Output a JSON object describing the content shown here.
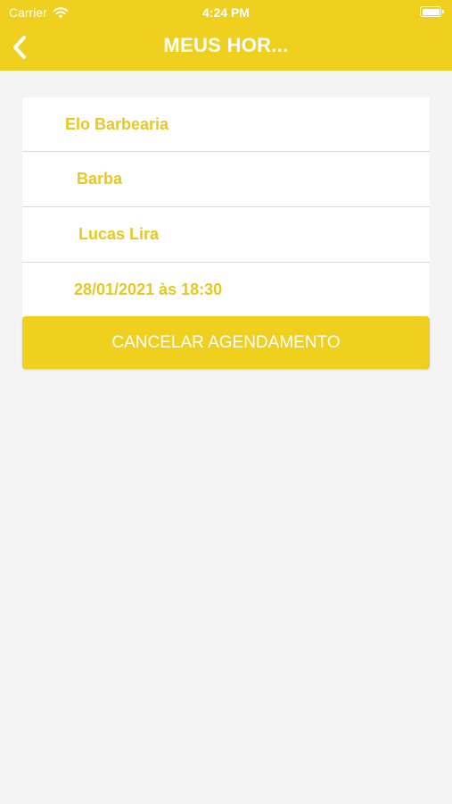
{
  "status_bar": {
    "carrier": "Carrier",
    "time": "4:24 PM",
    "wifi_icon": "wifi-icon",
    "battery_icon": "battery-icon"
  },
  "nav": {
    "back_icon": "chevron-left-icon",
    "title": "MEUS HOR..."
  },
  "appointment": {
    "barbershop": "Elo Barbearia",
    "service": "Barba",
    "barber": "Lucas Lira",
    "datetime": "28/01/2021 às 18:30"
  },
  "actions": {
    "cancel_label": "CANCELAR AGENDAMENTO"
  },
  "colors": {
    "brand_yellow": "#efd01e",
    "text_yellow": "#e9c81f",
    "background": "#f4f4f4"
  }
}
